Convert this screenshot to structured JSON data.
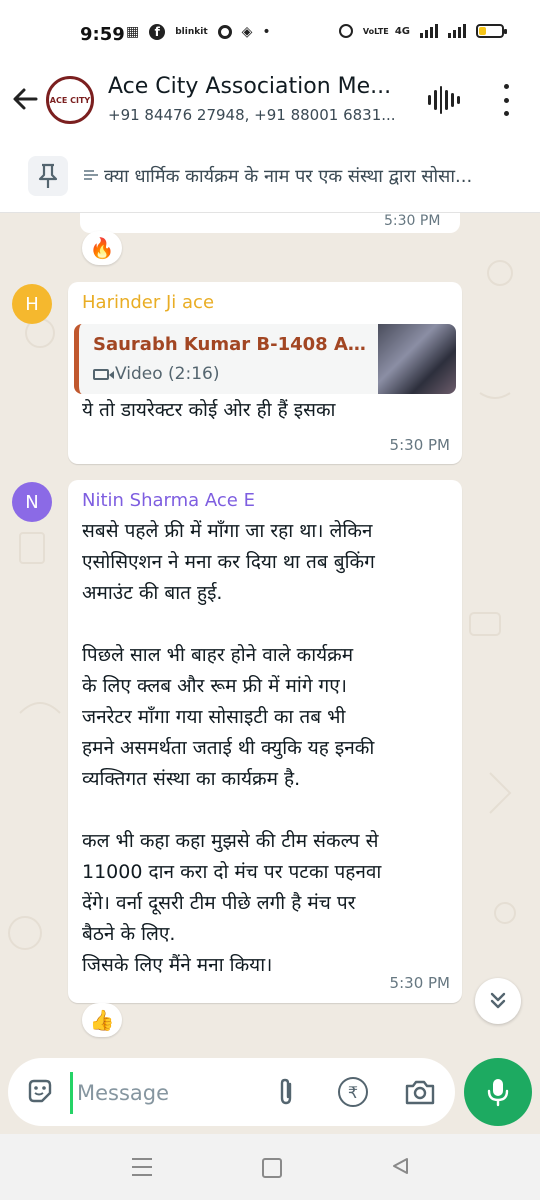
{
  "status_bar": {
    "time": "9:59",
    "left_icons": [
      "grid-app-icon",
      "facebook-icon",
      "blinkit-icon",
      "chrome-icon",
      "ticket-icon",
      "dot-icon"
    ],
    "blinkit_label": "blinkit",
    "network_label": "4G",
    "volte_label": "VoLTE",
    "battery_fraction": 0.3
  },
  "header": {
    "group_name": "Ace City Association Me...",
    "members": "+91 84476 27948, +91 88001 6831...",
    "avatar_text": "ACE CITY"
  },
  "pinned": {
    "text": "क्या धार्मिक कार्यक्रम के नाम पर एक संस्था द्वारा सोसा..."
  },
  "messages": {
    "prev": {
      "time": "5:30 PM",
      "reaction": "🔥"
    },
    "harinder": {
      "avatar_letter": "H",
      "avatar_color": "#f5b82e",
      "name": "Harinder Ji ace",
      "name_color": "#e9ad24",
      "quote_author": "Saurabh Kumar B-1408 Agr...",
      "quote_type": "Video (2:16)",
      "text": "ये तो डायरेक्टर कोई ओर ही हैं इसका",
      "time": "5:30 PM"
    },
    "nitin": {
      "avatar_letter": "N",
      "avatar_color": "#8b6ae6",
      "name": "Nitin Sharma Ace E",
      "name_color": "#7e5ee0",
      "text": "सबसे पहले फ्री में माँगा जा रहा था। लेकिन\nएसोसिएशन ने मना कर दिया था तब बुकिंग\nअमाउंट की बात हुई.\n\nपिछले साल भी बाहर होने वाले कार्यक्रम\nके लिए क्लब और रूम फ्री में मांगे गए।\nजनरेटर माँगा गया सोसाइटी का तब भी\nहमने असमर्थता जताई थी क्युकि यह इनकी\nव्यक्तिगत संस्था का कार्यक्रम है.\n\nकल भी कहा कहा मुझसे की टीम संकल्प से\n11000 दान करा दो मंच पर पटका पहनवा\nदेंगे। वर्ना दूसरी टीम पीछे लगी है मंच पर\nबैठने के लिए.\nजिसके लिए मैंने मना किया।",
      "time": "5:30 PM",
      "reaction": "👍"
    }
  },
  "composer": {
    "placeholder": "Message"
  },
  "colors": {
    "accent_green": "#1daa61",
    "chat_bg": "#efeae2",
    "quote_bar": "#c0582e"
  }
}
